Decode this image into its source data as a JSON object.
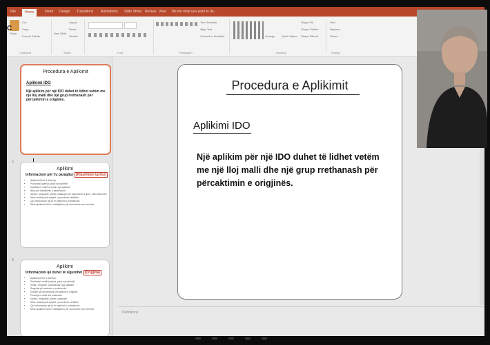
{
  "menu": {
    "tabs": [
      "File",
      "Home",
      "Insert",
      "Design",
      "Transitions",
      "Animations",
      "Slide Show",
      "Review",
      "View"
    ],
    "active_tab": "Home",
    "tell_me": "Tell me what you want to do..."
  },
  "ribbon": {
    "clipboard": {
      "paste": "Paste",
      "cut": "Cut",
      "copy": "Copy",
      "format_painter": "Format Painter",
      "label": "Clipboard"
    },
    "slides": {
      "new_slide": "New Slide",
      "layout": "Layout",
      "reset": "Reset",
      "section": "Section",
      "label": "Slides"
    },
    "font": {
      "label": "Font"
    },
    "paragraph": {
      "text_direction": "Text Direction",
      "align_text": "Align Text",
      "convert": "Convert to SmartArt",
      "label": "Paragraph"
    },
    "drawing": {
      "arrange": "Arrange",
      "quick_styles": "Quick Styles",
      "shape_fill": "Shape Fill",
      "shape_outline": "Shape Outline",
      "shape_effects": "Shape Effects",
      "label": "Drawing"
    },
    "editing": {
      "find": "Find",
      "replace": "Replace",
      "select": "Select",
      "label": "Editing"
    }
  },
  "thumbnails": [
    {
      "number": "",
      "title": "Procedura e Aplikimit",
      "subtitle": "Aplikimi IDO",
      "body": "Një aplikim për një IDO duhet të lidhet vetëm me një lloj malli dhe një grup rrethanash për përcaktimin e origjinës."
    },
    {
      "number": "2",
      "title": "Aplikimi",
      "heading": "Informacioni për t'u paraqitur",
      "heading_tag": "(Klasifikimi tarifor)",
      "items": [
        "Aplikanti (Emri & Adresa)",
        "Prodhuesi (adresa, pikat e prodhimit)",
        "Klasifikimi i mallit në kodin nga aplikanti",
        "Baza për klasifikimin e parashikuar",
        "Mostra, fotografitë, planet, katalogët ose dokumentet e tjera, nëse kërkohen",
        "Nëse mallrat janë subjekt i procedurës verifikimi",
        "Çdo informacion që do të trajtohet si konfidencial",
        "Nëse aplikanti është i vetëdijshëm për dokumente ose vendime"
      ]
    },
    {
      "number": "3",
      "title": "Aplikimi",
      "heading": "Informacioni që duhet të sigurohet",
      "heading_tag": "(Origjina)",
      "items": [
        "Aplikanti (Emri & Adresa)",
        "Prodhuesi i mallit (adresa, pikat e prodhimit)",
        "Vendi i Origjinës i parashikuar nga aplikanti",
        "Rregullat për statusin e preferencës",
        "Kushtet që mundësojnë përcaktimin e origjinës",
        "Përbërja e mallit dhe materialet",
        "Mostra, fotografitë, planet, katalogët",
        "Nëse mallrat janë subjekt i procedurës verifikimi",
        "Çdo informacion që do të trajtohet si konfidencial",
        "Nëse aplikanti është i vetëdijshëm për dokumente ose vendime"
      ]
    }
  ],
  "slide": {
    "title": "Procedura e Aplikimit",
    "subtitle": "Aplikimi IDO",
    "body": "Një aplikim për një IDO duhet të lidhet vetëm me një lloj malli dhe një grup rrethanash për përcaktimin e origjinës."
  },
  "notes": {
    "placeholder": "Definitions"
  },
  "accent_color": "#b7472a"
}
